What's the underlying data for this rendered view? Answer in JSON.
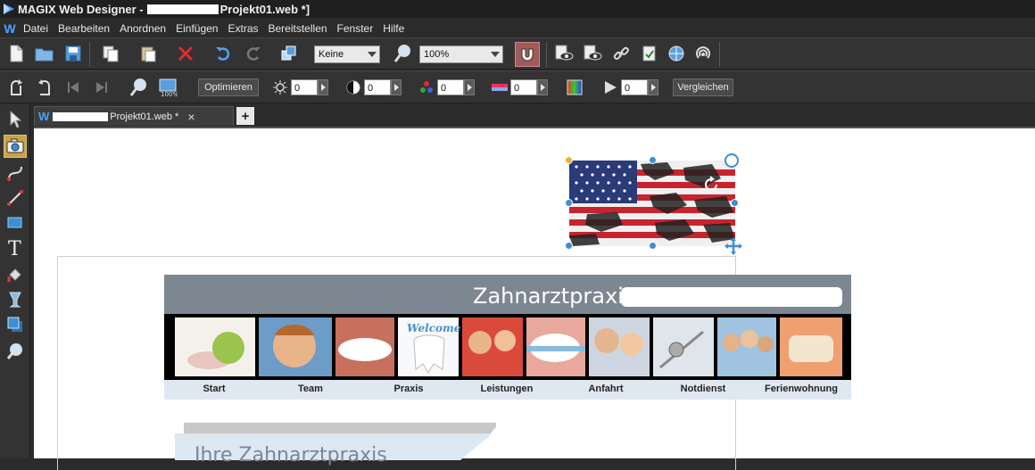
{
  "window": {
    "app_name": "MAGIX Web Designer - ",
    "title_suffix": "Projekt01.web *]"
  },
  "menu": [
    "Datei",
    "Bearbeiten",
    "Anordnen",
    "Einfügen",
    "Extras",
    "Bereitstellen",
    "Fenster",
    "Hilfe"
  ],
  "toolbar1": {
    "style_combo": "Keine",
    "zoom_combo": "100%"
  },
  "toolbar2": {
    "optimize_label": "Optimieren",
    "compare_label": "Vergleichen",
    "brightness": "0",
    "contrast": "0",
    "saturation": "0",
    "color_balance": "0",
    "sharpness": "0"
  },
  "tab": {
    "title": "Projekt01.web *",
    "close": "×",
    "new": "+"
  },
  "website": {
    "banner_title": "Zahnarztpraxis",
    "nav_items": [
      "Start",
      "Team",
      "Praxis",
      "Leistungen",
      "Anfahrt",
      "Notdienst",
      "Ferienwohnung"
    ],
    "heading": "Ihre Zahnarztpraxis"
  },
  "colors": {
    "banner": "#7d8792",
    "navbar": "#dfe8f0",
    "handle": "#3b8fd9",
    "accent_blue": "#4aa3ff"
  }
}
